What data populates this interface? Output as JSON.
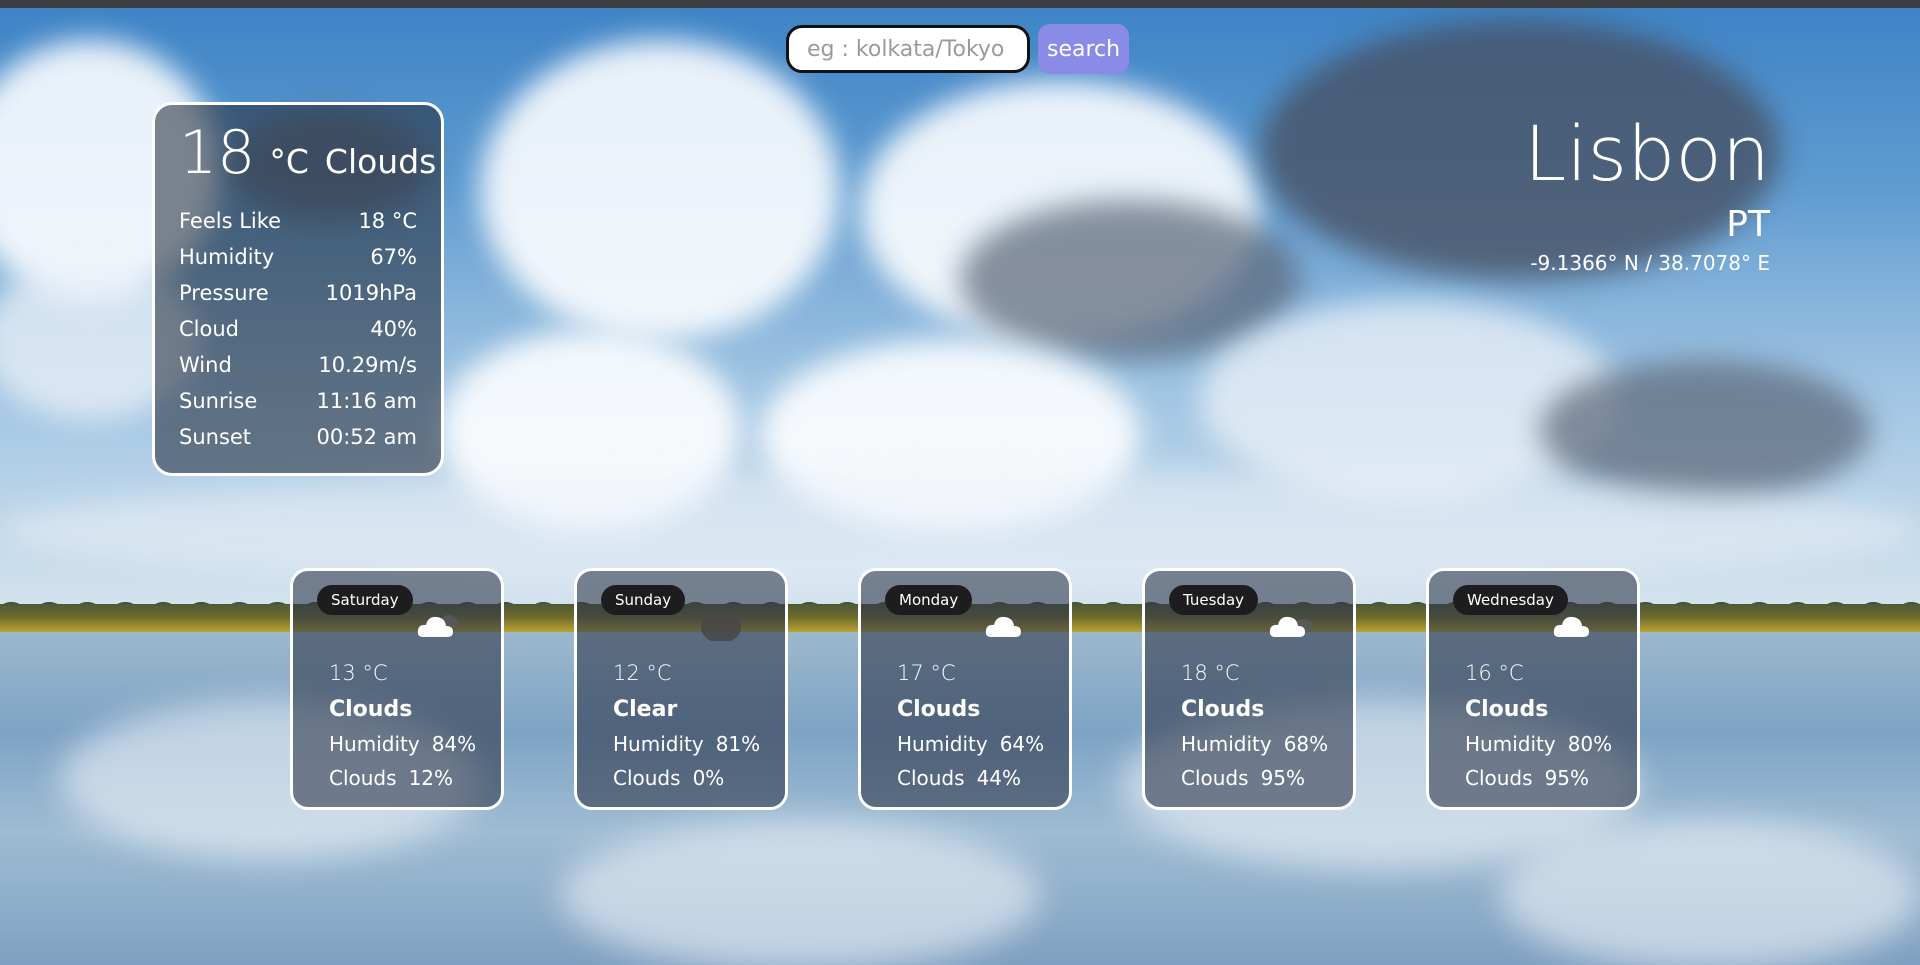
{
  "search": {
    "placeholder": "eg : kolkata/Tokyo",
    "button_label": "search"
  },
  "current": {
    "temp": "18",
    "unit": "°C",
    "condition": "Clouds",
    "details": [
      {
        "label": "Feels Like",
        "value": "18 °C"
      },
      {
        "label": "Humidity",
        "value": "67%"
      },
      {
        "label": "Pressure",
        "value": "1019hPa"
      },
      {
        "label": "Cloud",
        "value": "40%"
      },
      {
        "label": "Wind",
        "value": "10.29m/s"
      },
      {
        "label": "Sunrise",
        "value": "11:16 am"
      },
      {
        "label": "Sunset",
        "value": "00:52 am"
      }
    ]
  },
  "location": {
    "city": "Lisbon",
    "country": "PT",
    "coords": "-9.1366° N / 38.7078° E"
  },
  "forecast": [
    {
      "day": "Saturday",
      "temp": "13 °C",
      "condition": "Clouds",
      "humidity_label": "Humidity",
      "humidity": "84%",
      "clouds_label": "Clouds",
      "clouds": "12%",
      "icon": "cloud-icon"
    },
    {
      "day": "Sunday",
      "temp": "12 °C",
      "condition": "Clear",
      "humidity_label": "Humidity",
      "humidity": "81%",
      "clouds_label": "Clouds",
      "clouds": "0%",
      "icon": "moon-icon"
    },
    {
      "day": "Monday",
      "temp": "17 °C",
      "condition": "Clouds",
      "humidity_label": "Humidity",
      "humidity": "64%",
      "clouds_label": "Clouds",
      "clouds": "44%",
      "icon": "cloud-icon"
    },
    {
      "day": "Tuesday",
      "temp": "18 °C",
      "condition": "Clouds",
      "humidity_label": "Humidity",
      "humidity": "68%",
      "clouds_label": "Clouds",
      "clouds": "95%",
      "icon": "cloud-icon"
    },
    {
      "day": "Wednesday",
      "temp": "16 °C",
      "condition": "Clouds",
      "humidity_label": "Humidity",
      "humidity": "80%",
      "clouds_label": "Clouds",
      "clouds": "95%",
      "icon": "cloud-icon"
    }
  ],
  "colors": {
    "search_button": "#8a8be6",
    "panel_border": "#ffffff",
    "day_pill": "#1d1d1f"
  }
}
